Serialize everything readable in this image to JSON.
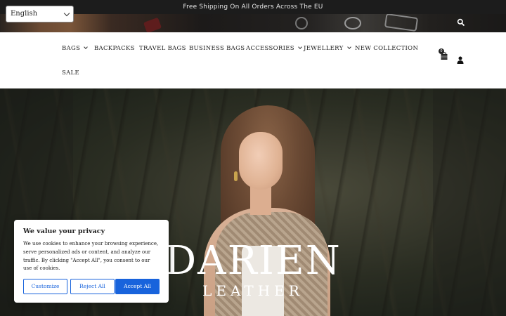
{
  "announcement": {
    "text": "Free Shipping On All Orders Across The EU"
  },
  "language_selector": {
    "selected": "English"
  },
  "nav": {
    "items": [
      {
        "label": "BAGS",
        "has_dropdown": true
      },
      {
        "label": "BACKPACKS",
        "has_dropdown": false
      },
      {
        "label": "TRAVEL BAGS",
        "has_dropdown": false
      },
      {
        "label": "BUSINESS BAGS",
        "has_dropdown": false
      },
      {
        "label": "ACCESSORIES",
        "has_dropdown": true
      },
      {
        "label": "JEWELLERY",
        "has_dropdown": true
      },
      {
        "label": "NEW COLLECTION",
        "has_dropdown": false
      },
      {
        "label": "SALE",
        "has_dropdown": false
      }
    ],
    "cart_count": "0"
  },
  "hero": {
    "brand_title": "DARIEN",
    "brand_subtitle": "LEATHER"
  },
  "cookie_banner": {
    "title": "We value your privacy",
    "body": "We use cookies to enhance your browsing experience, serve personalized ads or content, and analyze our traffic. By clicking \"Accept All\", you consent to our use of cookies.",
    "customize_label": "Customize",
    "reject_label": "Reject All",
    "accept_label": "Accept All",
    "accent_color": "#1863dc"
  },
  "icons": [
    "search-icon",
    "cart-icon",
    "account-icon",
    "chevron-down-icon"
  ]
}
